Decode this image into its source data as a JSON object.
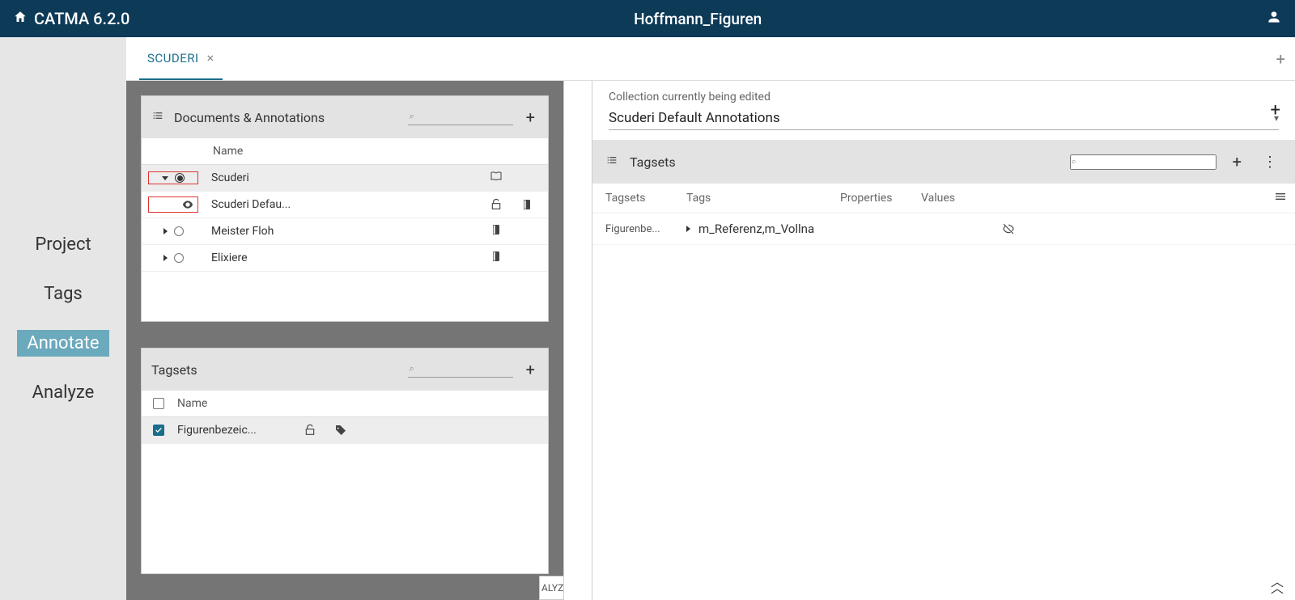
{
  "app": {
    "brand": "CATMA 6.2.0",
    "project_title": "Hoffmann_Figuren"
  },
  "sidenav": {
    "items": [
      "Project",
      "Tags",
      "Annotate",
      "Analyze"
    ],
    "active_index": 2
  },
  "tab": {
    "label": "SCUDERI"
  },
  "docs_panel": {
    "title": "Documents & Annotations",
    "col_name": "Name",
    "rows": [
      {
        "name": "Scuderi",
        "expanded": true,
        "radio_filled": true,
        "icon_right": "book",
        "highlight": true
      },
      {
        "name": "Scuderi Defau...",
        "child": true,
        "eye": true,
        "icon_right": "unlock-book",
        "highlight": true
      },
      {
        "name": "Meister Floh",
        "expanded": false,
        "radio_filled": false,
        "icon_right": "book-closed"
      },
      {
        "name": "Elixiere",
        "expanded": false,
        "radio_filled": false,
        "icon_right": "book-closed"
      }
    ]
  },
  "tagsets_panel": {
    "title": "Tagsets",
    "col_name": "Name",
    "row": {
      "name": "Figurenbezeic...",
      "checked": true
    }
  },
  "right_pane": {
    "collection_label": "Collection currently being edited",
    "collection_value": "Scuderi Default Annotations",
    "header_title": "Tagsets",
    "cols": {
      "c1": "Tagsets",
      "c2": "Tags",
      "c3": "Properties",
      "c4": "Values"
    },
    "row": {
      "tagset": "Figurenbe...",
      "tags": "m_Referenz,m_Vollna"
    }
  },
  "peek": "ALYZ"
}
